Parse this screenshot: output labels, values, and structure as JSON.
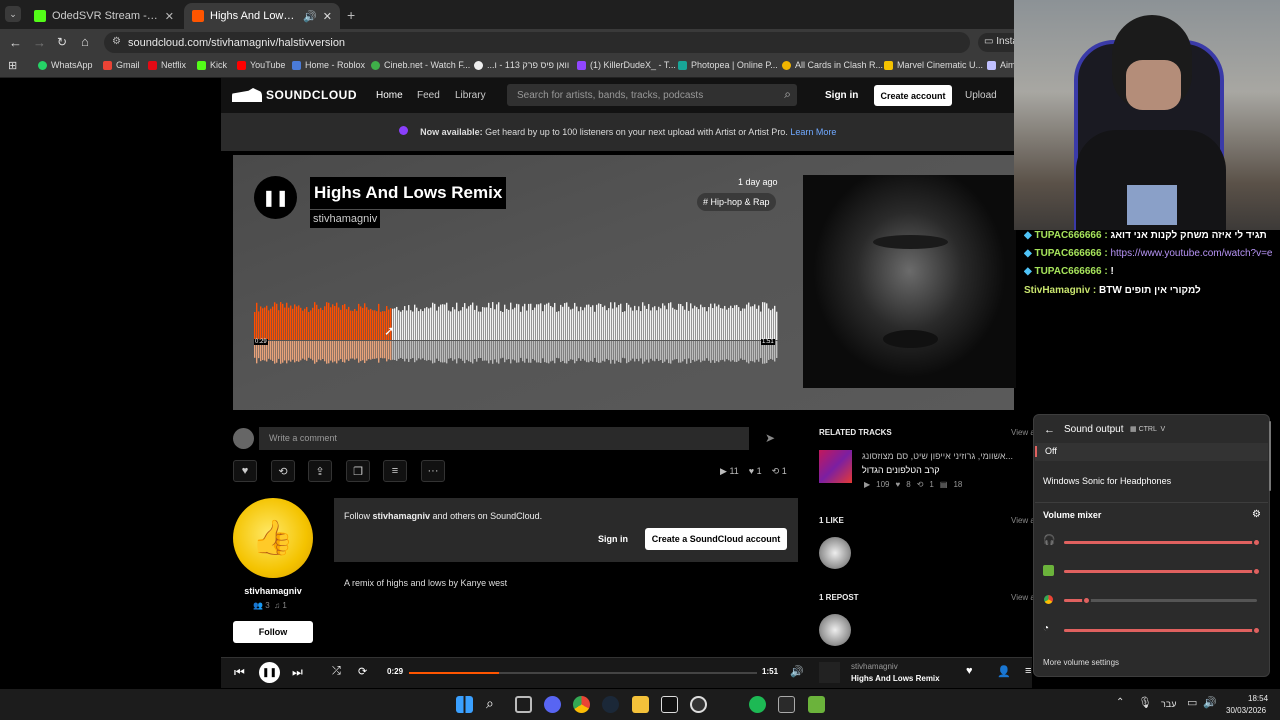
{
  "browser": {
    "tabs": [
      {
        "label": "OdedSVR Stream - Watch Live o",
        "favicon_color": "#53fc18"
      },
      {
        "label": "Highs And Lows Remix by s",
        "favicon_color": "#ff5500"
      }
    ],
    "url": "soundcloud.com/stivhamagniv/halstivversion",
    "url_host": "soundcloud.com",
    "install_label": "Insta",
    "bookmarks": [
      {
        "label": "WhatsApp",
        "color": "#25d366"
      },
      {
        "label": "Gmail",
        "color": "#ea4335"
      },
      {
        "label": "Netflix",
        "color": "#e50914"
      },
      {
        "label": "Kick",
        "color": "#53fc18"
      },
      {
        "label": "YouTube",
        "color": "#ff0000"
      },
      {
        "label": "Home - Roblox",
        "color": "#4a7bd8"
      },
      {
        "label": "Cineb.net - Watch F...",
        "color": "#3fae49"
      },
      {
        "label": "...וואן פיס פרק 113 - ו",
        "color": "#eeeeee"
      },
      {
        "label": "(1) KillerDudeX_ - T...",
        "color": "#9146ff"
      },
      {
        "label": "Photopea | Online P...",
        "color": "#18a497"
      },
      {
        "label": "All Cards in Clash R...",
        "color": "#f0b400"
      },
      {
        "label": "Marvel Cinematic U...",
        "color": "#f4c200"
      },
      {
        "label": "Aim",
        "color": "#c0c0ff"
      }
    ]
  },
  "soundcloud": {
    "logo": "SOUNDCLOUD",
    "nav": [
      "Home",
      "Feed",
      "Library"
    ],
    "search_placeholder": "Search for artists, bands, tracks, podcasts",
    "signin": "Sign in",
    "create_account": "Create account",
    "upload": "Upload",
    "banner_bold": "Now available:",
    "banner_text": " Get heard by up to 100 listeners on your next upload with Artist or Artist Pro.",
    "banner_link": "Learn More",
    "track": {
      "title": "Highs And Lows Remix",
      "artist": "stivhamagniv",
      "posted": "1 day ago",
      "genre": "# Hip-hop & Rap",
      "elapsed": "0:29",
      "duration": "1:51",
      "progress": 0.26
    },
    "comment_placeholder": "Write a comment",
    "stats": {
      "plays": "11",
      "likes": "1",
      "reposts": "1"
    },
    "follow_prompt_pre": "Follow ",
    "follow_prompt_user": "stivhamagniv",
    "follow_prompt_post": " and others on SoundCloud.",
    "follow_signin": "Sign in",
    "follow_create": "Create a SoundCloud account",
    "description": "A remix of highs and lows by Kanye west",
    "uploader": {
      "name": "stivhamagniv",
      "followers": "3",
      "tracks": "1",
      "follow_button": "Follow"
    },
    "related_header": "RELATED TRACKS",
    "view_all": "View a",
    "related": {
      "artist": "...אשוומי, גרוזיני אייפון שיט, סם מצוזסונג",
      "title": "קרב הטלפונים הגדול",
      "plays": "109",
      "likes": "8",
      "reposts": "1",
      "comments": "18"
    },
    "likes_header": "1 LIKE",
    "reposts_header": "1 REPOST",
    "player": {
      "elapsed": "0:29",
      "duration": "1:51",
      "artist": "stivhamagniv",
      "title": "Highs And Lows Remix",
      "progress": 0.26
    }
  },
  "chat": [
    {
      "user": "TUPAC666666 :",
      "message": "תגיד לי איזה משחק לקנות אני דואג",
      "link": false
    },
    {
      "user": "TUPAC666666 :",
      "message": "https://www.youtube.com/watch?v=e",
      "link": true
    },
    {
      "user": "TUPAC666666 :",
      "message": "!",
      "link": false
    },
    {
      "user": "StivHamagniv :",
      "message": "BTW למקורי אין תופים",
      "link": false
    }
  ],
  "sound_panel": {
    "title": "Sound output",
    "shortcut_ctrl": "CTRL",
    "shortcut_v": "V",
    "option_off": "Off",
    "option_sonic": "Windows Sonic for Headphones",
    "mixer_title": "Volume mixer",
    "levels": [
      1.0,
      1.0,
      0.12,
      1.0
    ],
    "more": "More volume settings"
  },
  "taskbar": {
    "lang": "עבר",
    "time": "18:54",
    "date": "30/03/2026"
  }
}
